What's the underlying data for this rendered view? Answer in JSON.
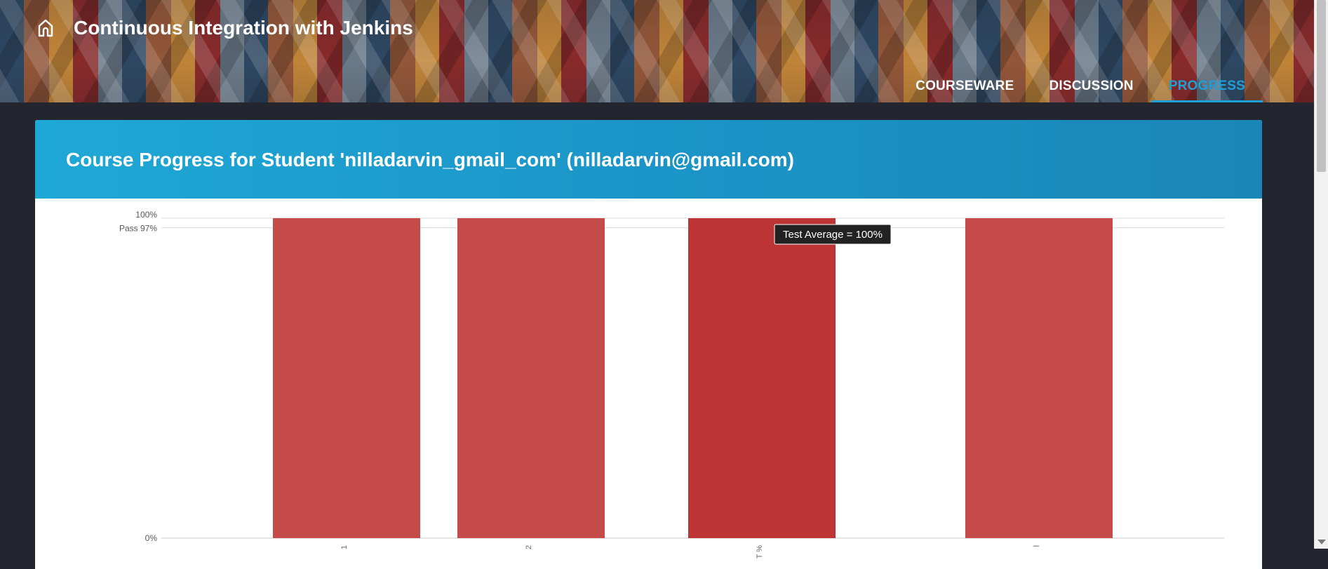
{
  "header": {
    "course_title": "Continuous Integration with Jenkins",
    "home_icon": "home-icon"
  },
  "nav": {
    "tabs": [
      {
        "label": "COURSEWARE",
        "active": false
      },
      {
        "label": "DISCUSSION",
        "active": false
      },
      {
        "label": "PROGRESS",
        "active": true
      }
    ]
  },
  "progress": {
    "title": "Course Progress for Student 'nilladarvin_gmail_com' (nilladarvin@gmail.com)"
  },
  "colors": {
    "accent": "#1e9fd6",
    "bar": "#c54b4b",
    "bar_highlight": "#bd3434",
    "card_header": "#1ea8d6",
    "page_bg": "#23252f"
  },
  "chart_data": {
    "type": "bar",
    "ylim": [
      0,
      100
    ],
    "y_ticks": [
      {
        "value": 100,
        "label": "100%"
      },
      {
        "value": 97,
        "label": "Pass 97%"
      },
      {
        "value": 0,
        "label": "0%"
      }
    ],
    "categories": [
      "1",
      "2",
      "T\n%",
      "l"
    ],
    "values": [
      100,
      100,
      100,
      100
    ],
    "highlighted_index": 2,
    "tooltip": "Test Average = 100%",
    "grid": true
  }
}
